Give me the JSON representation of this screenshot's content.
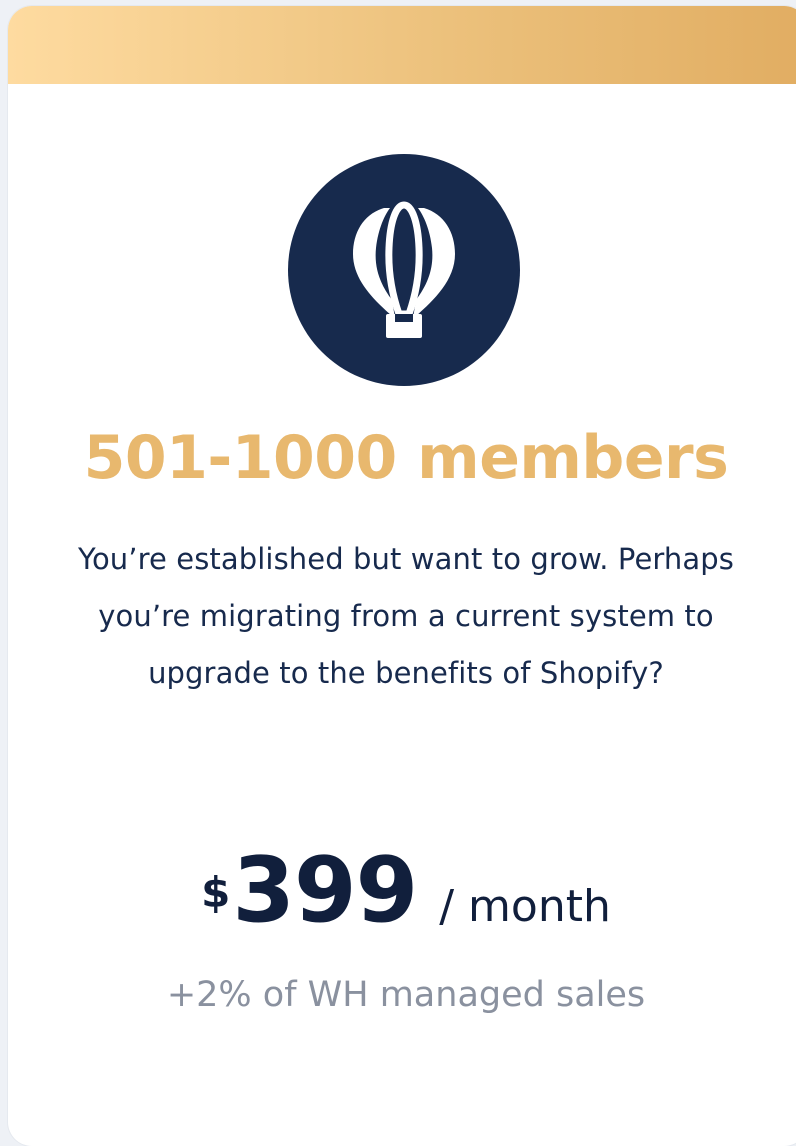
{
  "card": {
    "icon": "hot-air-balloon-icon",
    "title": "501-1000 members",
    "description": "You’re established but want to grow. Perhaps you’re migrating from a current system to upgrade to the benefits of Shopify?",
    "price": {
      "currency": "$",
      "amount": "399",
      "period": "/ month"
    },
    "fee_note": "+2% of WH managed sales"
  },
  "colors": {
    "header_gradient_start": "#fedba0",
    "header_gradient_end": "#e1ad62",
    "badge_background": "#172a4d",
    "title": "#e8b86e",
    "text_dark": "#172a4d",
    "fee_text": "#8a919f"
  }
}
